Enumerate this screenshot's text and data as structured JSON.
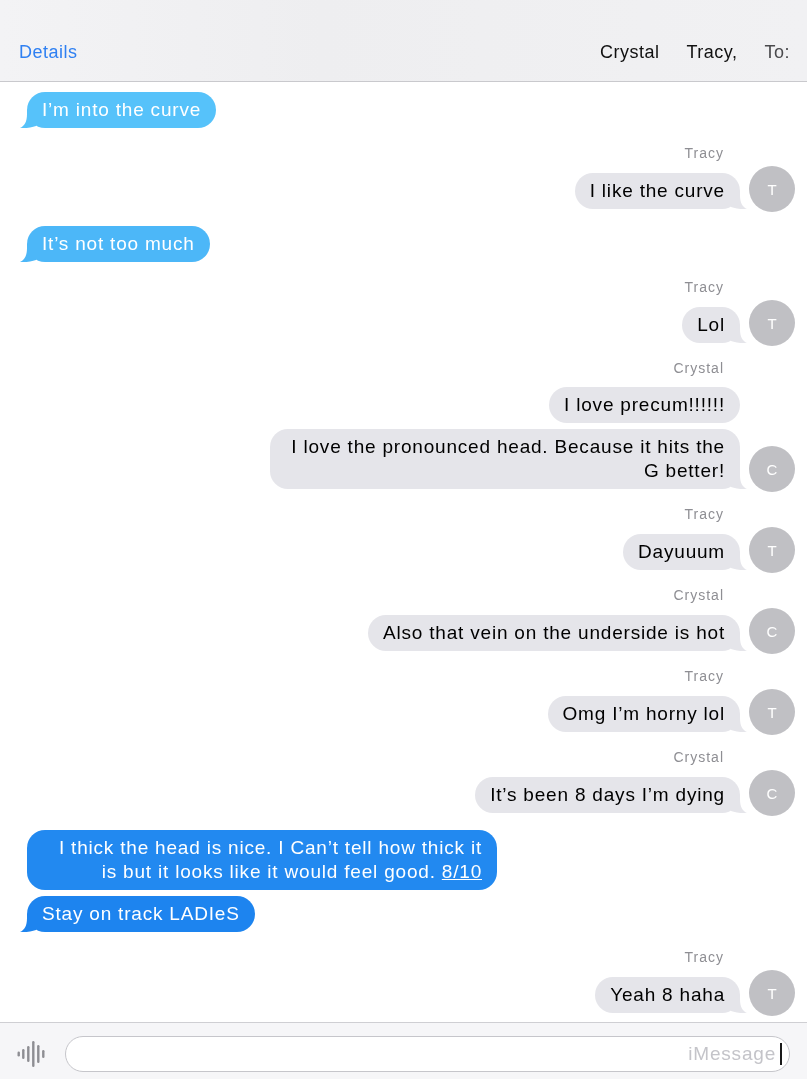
{
  "header": {
    "details": "Details",
    "recipients": [
      "Crystal",
      "Tracy,"
    ],
    "to_label": "To:"
  },
  "messages": [
    {
      "kind": "outgoing",
      "text": "I’m into the curve",
      "tail": true
    },
    {
      "kind": "incoming",
      "sender": "Tracy",
      "avatar": "T",
      "text": "I like the curve",
      "tail": true
    },
    {
      "kind": "outgoing",
      "text": "It’s not too much",
      "tail": true
    },
    {
      "kind": "incoming",
      "sender": "Tracy",
      "avatar": "T",
      "text": "Lol",
      "tail": true
    },
    {
      "kind": "incoming",
      "sender": "Crystal",
      "text": "I love precum!!!!!!",
      "tail": false
    },
    {
      "kind": "incoming",
      "avatar": "C",
      "text": "I love the pronounced head. Because it hits the G better!",
      "tail": true
    },
    {
      "kind": "incoming",
      "sender": "Tracy",
      "avatar": "T",
      "text": "Dayuuum",
      "tail": true
    },
    {
      "kind": "incoming",
      "sender": "Crystal",
      "avatar": "C",
      "text": "Also that vein on the underside is hot",
      "tail": true
    },
    {
      "kind": "incoming",
      "sender": "Tracy",
      "avatar": "T",
      "text": "Omg I’m horny lol",
      "tail": true
    },
    {
      "kind": "incoming",
      "sender": "Crystal",
      "avatar": "C",
      "text": "It’s been 8 days I’m dying",
      "tail": true
    },
    {
      "kind": "outgoing",
      "text": "I thick the head is nice. I Can’t tell how thick it is but it looks like it would feel good.",
      "link": "8/10",
      "tail": false
    },
    {
      "kind": "outgoing",
      "text": "Stay on track LADIeS",
      "tail": true
    },
    {
      "kind": "incoming",
      "sender": "Tracy",
      "avatar": "T",
      "text": "Yeah 8 haha",
      "tail": true
    }
  ],
  "composer": {
    "placeholder": "iMessage"
  }
}
